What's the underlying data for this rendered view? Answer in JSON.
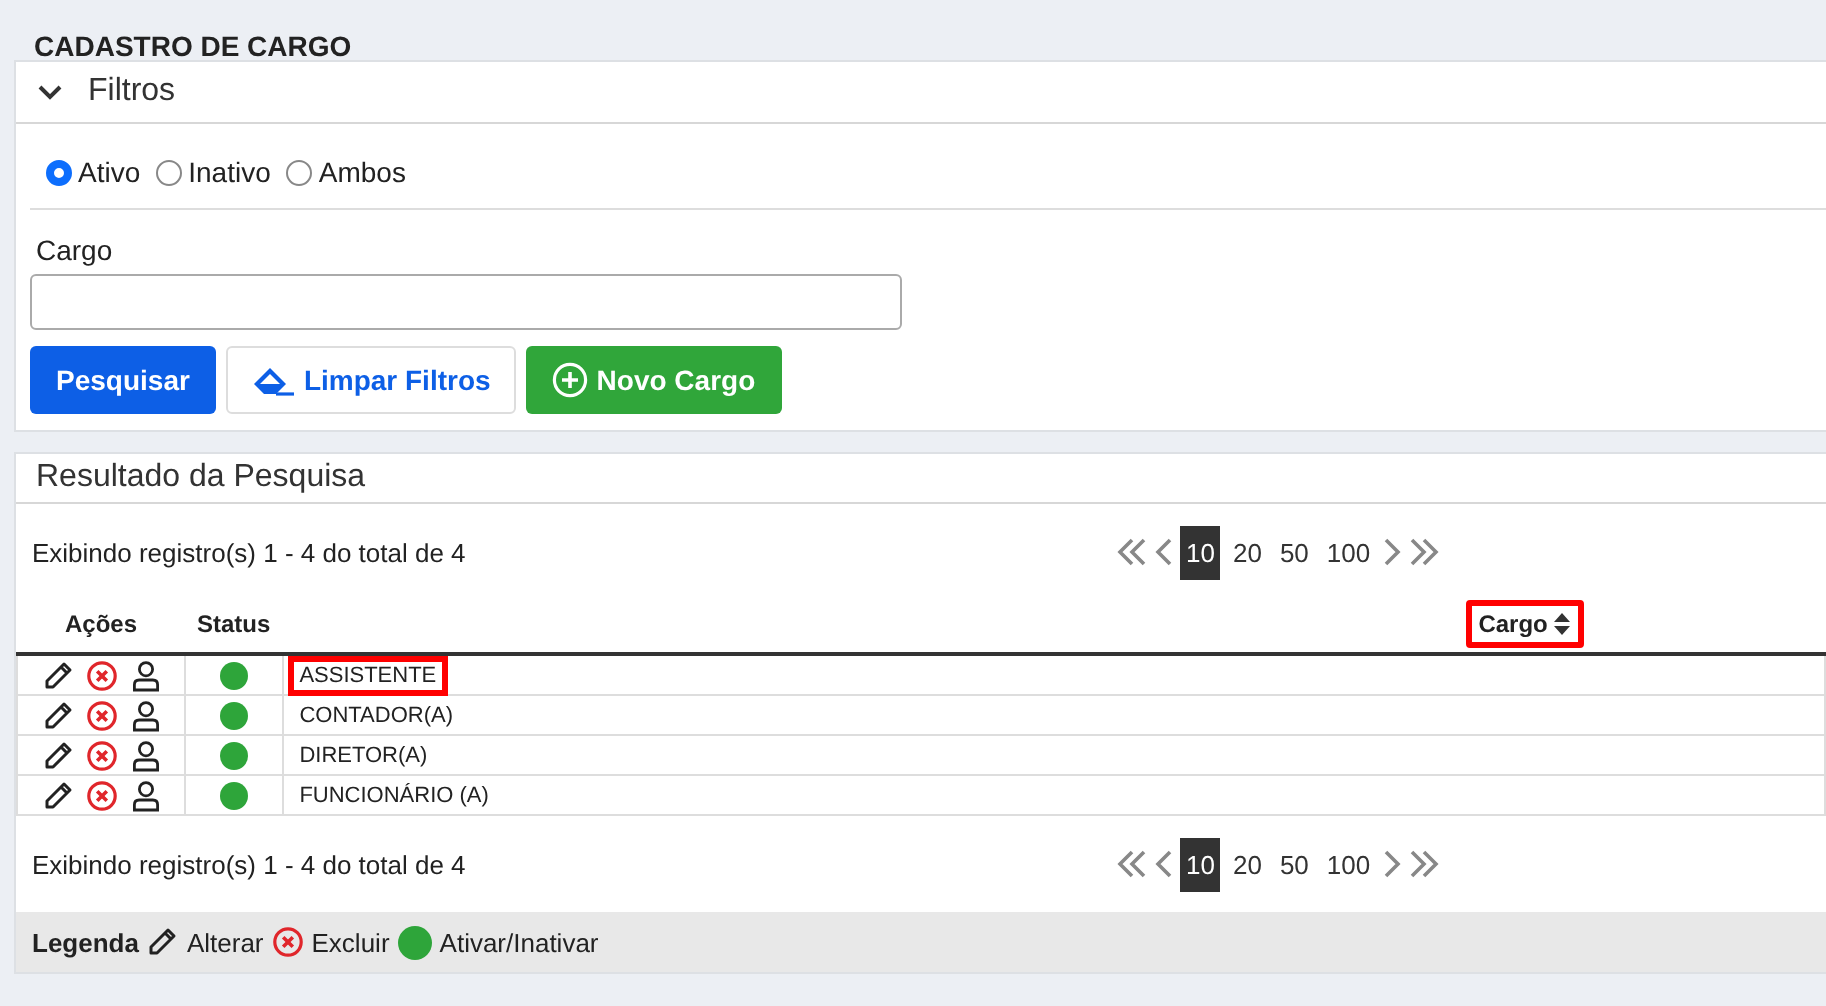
{
  "page_title": "CADASTRO DE CARGO",
  "filters": {
    "title": "Filtros",
    "expanded": true,
    "status_options": [
      {
        "label": "Ativo",
        "selected": true
      },
      {
        "label": "Inativo",
        "selected": false
      },
      {
        "label": "Ambos",
        "selected": false
      }
    ],
    "cargo_field": {
      "label": "Cargo"
    },
    "buttons": [
      {
        "kind": "primary",
        "label": "Pesquisar"
      },
      {
        "kind": "eraser",
        "label": "Limpar Filtros"
      },
      {
        "kind": "add",
        "label": "Novo Cargo"
      }
    ]
  },
  "results": {
    "title": "Resultado da Pesquisa",
    "summary_top": "Exibindo registro(s) 1 - 4 do total de 4",
    "page_sizes_top": [
      {
        "label": "10",
        "selected": true
      },
      {
        "label": "20",
        "selected": false
      },
      {
        "label": "50",
        "selected": false
      },
      {
        "label": "100",
        "selected": false
      }
    ],
    "columns": [
      {
        "label": "Ações",
        "highlighted": false
      },
      {
        "label": "Status",
        "highlighted": false
      },
      {
        "label": "Cargo",
        "sortable": true,
        "highlighted": true
      }
    ],
    "rows": [
      {
        "cargo": "ASSISTENTE",
        "color": "#2ea53a",
        "highlighted": true
      },
      {
        "cargo": "CONTADOR(A)",
        "color": "#2ea53a",
        "highlighted": false
      },
      {
        "cargo": "DIRETOR(A)",
        "color": "#2ea53a",
        "highlighted": false
      },
      {
        "cargo": "FUNCIONÁRIO (A)",
        "color": "#2ea53a",
        "highlighted": false
      }
    ],
    "summary_bottom": "Exibindo registro(s) 1 - 4 do total de 4",
    "page_sizes_bottom": [
      {
        "label": "10",
        "selected": true
      },
      {
        "label": "20",
        "selected": false
      },
      {
        "label": "50",
        "selected": false
      },
      {
        "label": "100",
        "selected": false
      }
    ]
  },
  "legend": {
    "title": "Legenda",
    "items": [
      {
        "kind": "edit",
        "label": "Alterar"
      },
      {
        "kind": "delete",
        "label": "Excluir"
      },
      {
        "kind": "status",
        "label": "Ativar/Inativar",
        "color": "#2ea53a"
      }
    ]
  }
}
